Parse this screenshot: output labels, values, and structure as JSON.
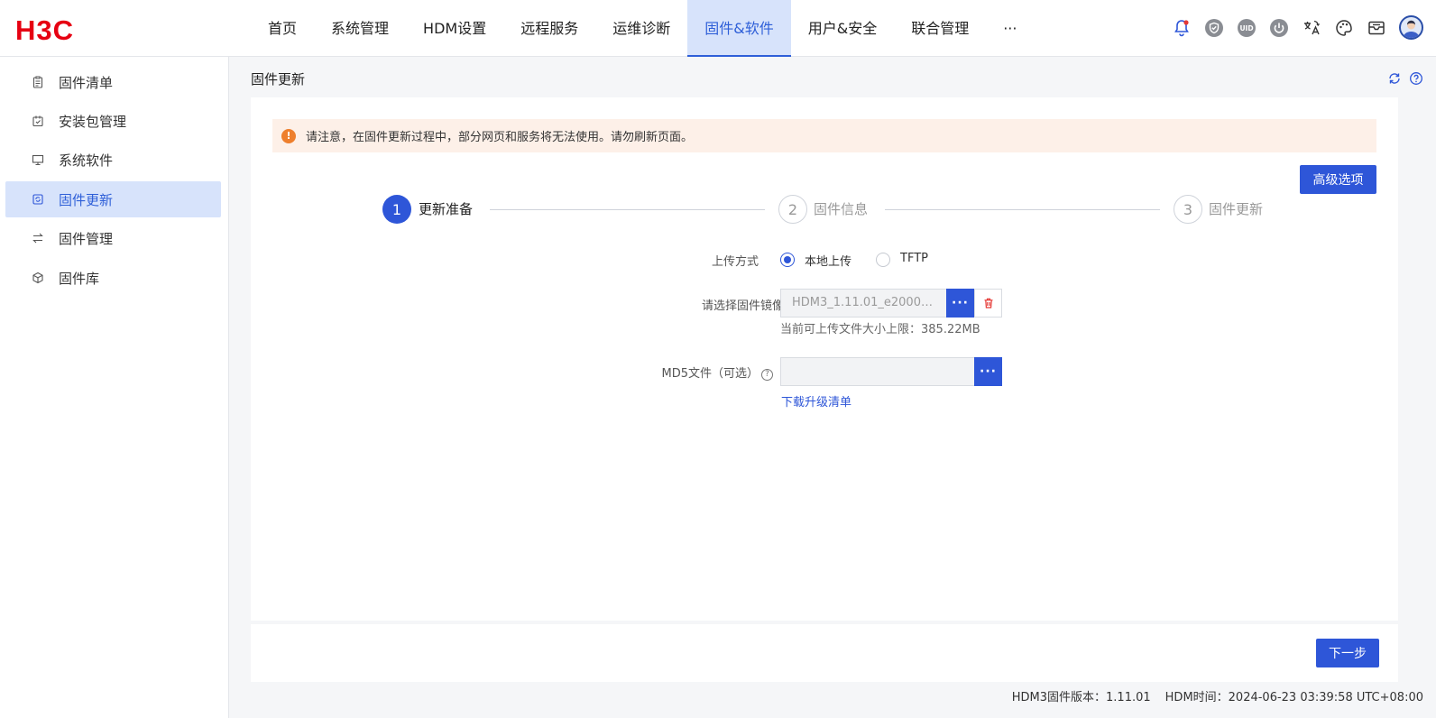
{
  "brand": {
    "logo_text": "H3C",
    "logo_color": "#e60012"
  },
  "colors": {
    "accent": "#2e56d8",
    "active_bg": "#d7e3fb",
    "warning": "#ee7f2d",
    "alert_bg": "#fdf0e8"
  },
  "nav": {
    "items": [
      {
        "label": "首页"
      },
      {
        "label": "系统管理"
      },
      {
        "label": "HDM设置"
      },
      {
        "label": "远程服务"
      },
      {
        "label": "运维诊断"
      },
      {
        "label": "固件&软件",
        "active": true
      },
      {
        "label": "用户&安全"
      },
      {
        "label": "联合管理"
      },
      {
        "label": "···"
      }
    ],
    "header_icons": [
      "bell-icon",
      "shield-icon",
      "uid-icon",
      "power-icon",
      "language-icon",
      "palette-icon",
      "mail-icon",
      "user-avatar-icon"
    ],
    "uid_text": "UID"
  },
  "sidebar": {
    "items": [
      {
        "label": "固件清单",
        "icon": "clipboard-icon"
      },
      {
        "label": "安装包管理",
        "icon": "package-icon"
      },
      {
        "label": "系统软件",
        "icon": "monitor-icon"
      },
      {
        "label": "固件更新",
        "icon": "chip-refresh-icon",
        "active": true
      },
      {
        "label": "固件管理",
        "icon": "swap-icon"
      },
      {
        "label": "固件库",
        "icon": "cube-icon"
      }
    ]
  },
  "page": {
    "title": "固件更新",
    "title_icons": [
      "refresh-icon",
      "help-icon"
    ],
    "alert": {
      "icon_text": "!",
      "text": "请注意，在固件更新过程中，部分网页和服务将无法使用。请勿刷新页面。"
    },
    "advanced_button": "高级选项",
    "steps": [
      {
        "num": "1",
        "label": "更新准备",
        "active": true
      },
      {
        "num": "2",
        "label": "固件信息",
        "active": false
      },
      {
        "num": "3",
        "label": "固件更新",
        "active": false
      }
    ],
    "form": {
      "upload_mode_label": "上传方式",
      "upload_modes": [
        {
          "label": "本地上传",
          "checked": true
        },
        {
          "label": "TFTP",
          "checked": false
        }
      ],
      "image_label": "请选择固件镜像",
      "image_value": "HDM3_1.11.01_e2000_...",
      "browse_text": "···",
      "size_hint": "当前可上传文件大小上限：385.22MB",
      "md5_label": "MD5文件（可选）",
      "md5_help": "?",
      "md5_value": "",
      "download_link": "下载升级清单"
    },
    "next_button": "下一步"
  },
  "status": {
    "firmware_version": "HDM3固件版本：1.11.01",
    "hdm_time": "HDM时间：2024-06-23 03:39:58 UTC+08:00"
  }
}
